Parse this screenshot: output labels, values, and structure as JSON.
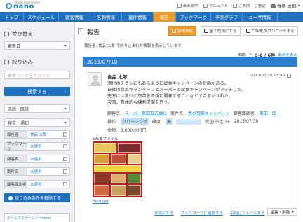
{
  "header": {
    "logo_sub": "Cybozu Brandname",
    "logo_name": "nano",
    "links": [
      "画面説明",
      "マニュアル",
      "ご質問・ご要望"
    ],
    "user": "食品 太郎"
  },
  "nav": {
    "tabs": [
      "トップ",
      "スケジュール",
      "顧客情報",
      "名刺情報",
      "案件情報",
      "報告",
      "ブックマーク",
      "予実グラフ",
      "ユーザ情報"
    ],
    "active_index": 5
  },
  "sidebar": {
    "sort_title": "並び替え",
    "sort_value": "更新日",
    "filter_title": "絞り込み",
    "keyword_placeholder": "検索ワードを入力する",
    "search_button": "検索する",
    "status_value": "未読・既読",
    "type_value": "報告・通知",
    "filters": [
      {
        "label": "報告者",
        "value": "食品 太郎"
      },
      {
        "label": "ブックマーク",
        "value": "未選択"
      },
      {
        "label": "顧客名",
        "value": "未選択"
      },
      {
        "label": "案件名",
        "value": "未選択"
      },
      {
        "label": "顧客面談者",
        "value": "未選択"
      }
    ],
    "clear_button": "絞り込み条件を解除する",
    "app_box": "ホールスマナージャーnano"
  },
  "main": {
    "title": "報告",
    "new_button": "新規作成",
    "read_all_button": "全て既読にする",
    "csv_button": "CSVをダウンロードする",
    "info_text": "報告者: 食品 太郎 で絞り込まれた情報を表示しています。",
    "unread_label": "未読:",
    "unread_count": "0",
    "range": "0-6 / 6件",
    "latest_link": "最新を表示",
    "date": "2013/07/10"
  },
  "report": {
    "author": "食品 太郎",
    "time": "2013/07/10 13:49",
    "body": [
      "酒付のチラシにもあるように試食キャンペーンの計画がある。",
      "自社の惣菜キャンペーンとスーパーの試食キャンペーンがマッチした。",
      "先方には自社の惣菜を新規に開発することなどで合意がされた。",
      "次回、具体的な練判提案を行う。"
    ],
    "customer_label": "顧客名:",
    "customer": "スーパー築田株式会社",
    "project_label": "案件名:",
    "project": "春の惣菜キャンペーン",
    "contact_label": "顧客面談者:",
    "contact": "築田一郎",
    "feeling_label": "操作:",
    "feeling": "クロージング",
    "certainty_label": "確度:",
    "certainty": "高",
    "order_label": "受注(予定)日:",
    "order_date": "2013/07/30",
    "amount_label": "金額:",
    "amount": "3,000,000円",
    "image_label": "※画像ファイル",
    "file_name": "food.jpg"
  },
  "footer": {
    "links": [
      "未読にする",
      "ブックマークに追加する",
      "引用してメールする"
    ],
    "edit_button": "編集・削除"
  },
  "colors": {
    "nav": "#1f6fbf",
    "active_tab": "#f09b28",
    "date_bar": "#2c7ed0",
    "link": "#1d7fc4"
  }
}
